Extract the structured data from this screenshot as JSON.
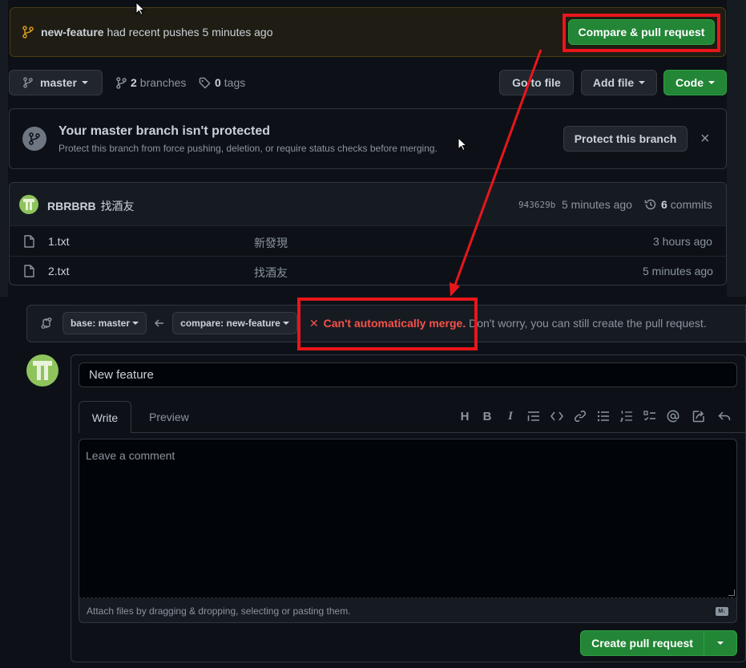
{
  "banner": {
    "branch": "new-feature",
    "message": "had recent pushes 5 minutes ago",
    "compare_button": "Compare & pull request"
  },
  "repo_bar": {
    "branch_select": "master",
    "branches_count": "2",
    "branches_label": "branches",
    "tags_count": "0",
    "tags_label": "tags",
    "go_to_file": "Go to file",
    "add_file": "Add file",
    "code": "Code"
  },
  "protect": {
    "title": "Your master branch isn't protected",
    "description": "Protect this branch from force pushing, deletion, or require status checks before merging.",
    "button": "Protect this branch",
    "close": "×"
  },
  "commit": {
    "author": "RBRBRB",
    "message": "找酒友",
    "hash": "943629b",
    "time": "5 minutes ago",
    "commits_count": "6",
    "commits_label": "commits"
  },
  "files": [
    {
      "name": "1.txt",
      "message": "新發現",
      "time": "3 hours ago"
    },
    {
      "name": "2.txt",
      "message": "找酒友",
      "time": "5 minutes ago"
    }
  ],
  "compare": {
    "base": "base: master",
    "head": "compare: new-feature",
    "merge_error": "Can't automatically merge.",
    "merge_hint": "Don't worry, you can still create the pull request."
  },
  "pr_form": {
    "title_value": "New feature",
    "tab_write": "Write",
    "tab_preview": "Preview",
    "toolbar": [
      "heading-icon",
      "bold-icon",
      "italic-icon",
      "quote-icon",
      "code-icon",
      "link-icon",
      "unordered-list-icon",
      "ordered-list-icon",
      "task-list-icon",
      "mention-icon",
      "reference-icon",
      "reply-icon"
    ],
    "comment_placeholder": "Leave a comment",
    "attach_hint": "Attach files by dragging & dropping, selecting or pasting them.",
    "markdown_badge": "M↓",
    "create_button": "Create pull request"
  },
  "colors": {
    "background": "#0d1117",
    "accent_green": "#238636",
    "error_red": "#f85149",
    "annotation_red": "#e8161c",
    "banner_bg": "#1f1c13"
  }
}
